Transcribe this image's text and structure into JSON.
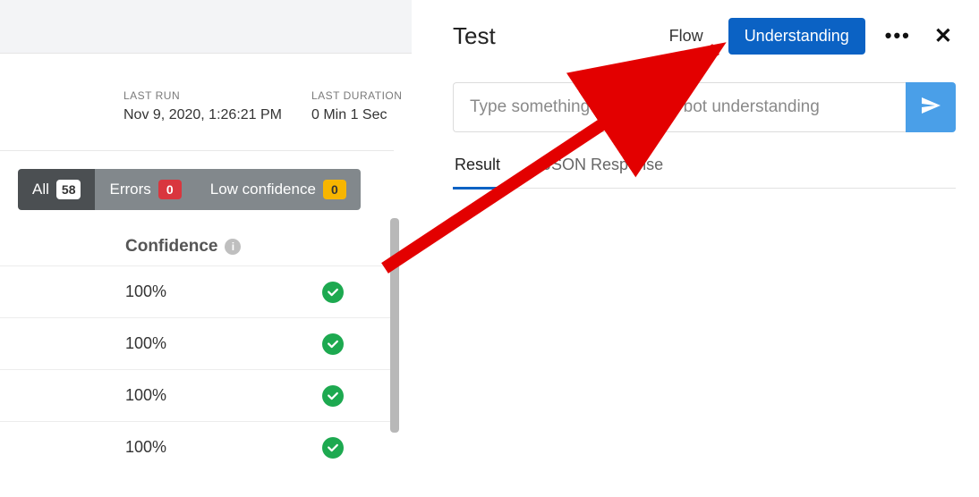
{
  "left": {
    "last_run_label": "LAST RUN",
    "last_run_value": "Nov 9, 2020, 1:26:21 PM",
    "last_duration_label": "LAST DURATION",
    "last_duration_value": "0 Min 1 Sec",
    "filters": {
      "all_label": "All",
      "all_count": "58",
      "errors_label": "Errors",
      "errors_count": "0",
      "lowconf_label": "Low confidence",
      "lowconf_count": "0"
    },
    "confidence_header": "Confidence",
    "rows": [
      {
        "value": "100%"
      },
      {
        "value": "100%"
      },
      {
        "value": "100%"
      },
      {
        "value": "100%"
      }
    ]
  },
  "right": {
    "title": "Test",
    "mode_flow": "Flow",
    "mode_understanding": "Understanding",
    "input_placeholder": "Type something to test your bot understanding",
    "tabs": {
      "result": "Result",
      "json": "JSON Response"
    }
  }
}
